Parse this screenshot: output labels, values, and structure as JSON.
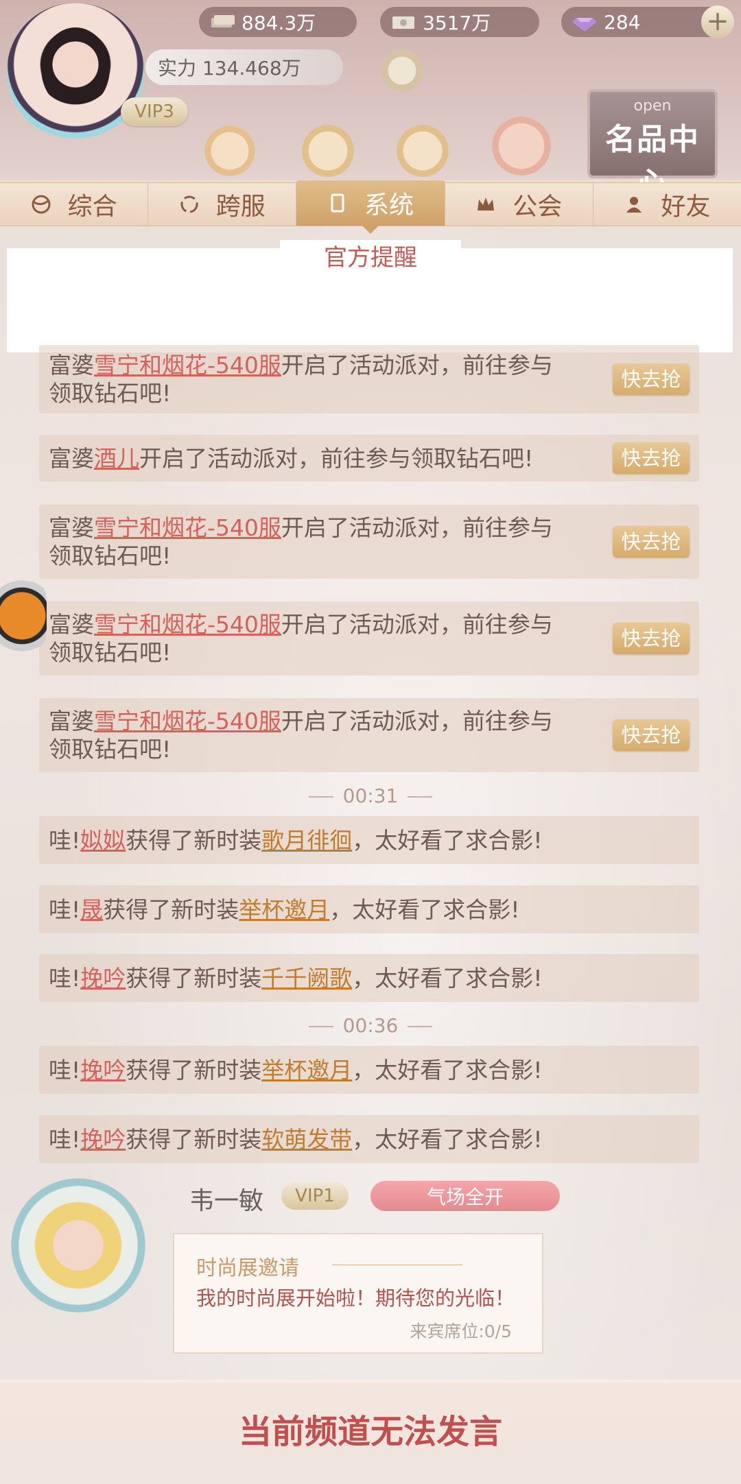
{
  "top": {
    "resources": [
      {
        "icon": "money-stack-icon",
        "value": "884.3万"
      },
      {
        "icon": "cash-icon",
        "value": "3517万"
      },
      {
        "icon": "diamond-icon",
        "value": "284"
      }
    ],
    "power": "实力 134.468万",
    "vip": "VIP3",
    "brand": {
      "open": "open",
      "title": "名品中心"
    }
  },
  "tabs": [
    {
      "label": "综合",
      "icon": "globe-icon"
    },
    {
      "label": "跨服",
      "icon": "swirl-icon"
    },
    {
      "label": "系统",
      "icon": "phone-icon",
      "active": true
    },
    {
      "label": "公会",
      "icon": "crown-icon"
    },
    {
      "label": "好友",
      "icon": "person-icon"
    }
  ],
  "notice_title": "官方提醒",
  "messages": {
    "party": [
      {
        "prefix": "富婆",
        "name": "雪宁和烟花-540服",
        "line1": "开启了活动派对，前往参与",
        "line2": "领取钻石吧!",
        "button": "快去抢"
      },
      {
        "prefix": "富婆",
        "name": "酒儿",
        "line1": "开启了活动派对，前往参与领取钻石吧!",
        "line2": "",
        "button": "快去抢"
      },
      {
        "prefix": "富婆",
        "name": "雪宁和烟花-540服",
        "line1": "开启了活动派对，前往参与",
        "line2": "领取钻石吧!",
        "button": "快去抢"
      },
      {
        "prefix": "富婆",
        "name": "雪宁和烟花-540服",
        "line1": "开启了活动派对，前往参与",
        "line2": "领取钻石吧!",
        "button": "快去抢"
      },
      {
        "prefix": "富婆",
        "name": "雪宁和烟花-540服",
        "line1": "开启了活动派对，前往参与",
        "line2": "领取钻石吧!",
        "button": "快去抢"
      }
    ],
    "time1": "00:31",
    "fashion1": [
      {
        "pre": "哇!",
        "name": "姒姒",
        "mid": "获得了新时装",
        "item": "歌月徘徊",
        "end": "，太好看了求合影!"
      },
      {
        "pre": "哇!",
        "name": "晟",
        "mid": "获得了新时装",
        "item": "举杯邀月",
        "end": "，太好看了求合影!"
      },
      {
        "pre": "哇!",
        "name": "挽吟",
        "mid": "获得了新时装",
        "item": "千千阙歌",
        "end": "，太好看了求合影!"
      }
    ],
    "time2": "00:36",
    "fashion2": [
      {
        "pre": "哇!",
        "name": "挽吟",
        "mid": "获得了新时装",
        "item": "举杯邀月",
        "end": "，太好看了求合影!"
      },
      {
        "pre": "哇!",
        "name": "挽吟",
        "mid": "获得了新时装",
        "item": "软萌发带",
        "end": "，太好看了求合影!"
      }
    ]
  },
  "invite": {
    "name": "韦一敏",
    "vip": "VIP1",
    "tag": "气场全开",
    "card_title": "时尚展邀请",
    "card_body": "我的时尚展开始啦！期待您的光临！",
    "card_seat": "来宾席位:0/5"
  },
  "footer": "当前频道无法发言",
  "colors": {
    "accent_red": "#d4615c",
    "accent_gold": "#c27c2f",
    "tab_active": "#cfa26a"
  }
}
